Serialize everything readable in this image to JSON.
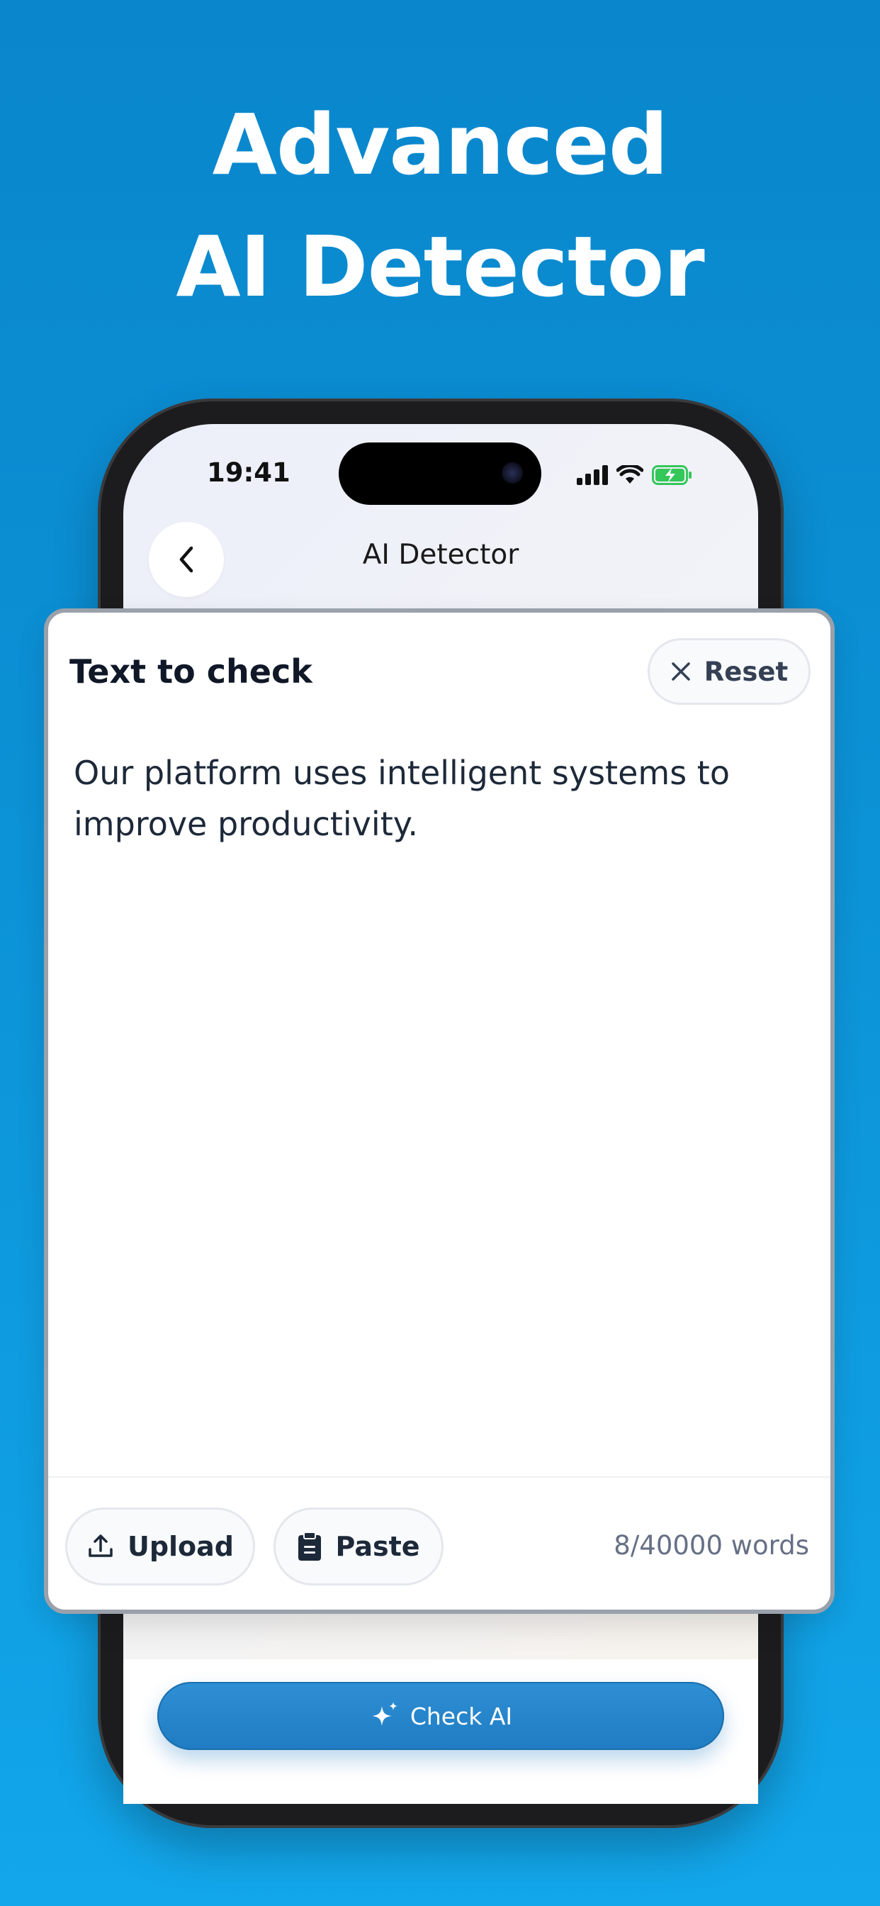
{
  "headline": {
    "line1": "Advanced",
    "line2": "AI Detector"
  },
  "status_bar": {
    "time": "19:41",
    "icons": [
      "cellular-signal-icon",
      "wifi-icon",
      "battery-charging-icon"
    ]
  },
  "nav": {
    "title": "AI Detector",
    "back_icon": "chevron-left-icon"
  },
  "card": {
    "title": "Text to check",
    "reset_label": "Reset",
    "text": "Our platform uses intelligent systems to improve productivity.",
    "upload_label": "Upload",
    "paste_label": "Paste",
    "word_count": "8/40000 words"
  },
  "check_button": {
    "label": "Check AI",
    "icon": "sparkles-icon"
  },
  "colors": {
    "background": "#0c92d6",
    "accent": "#1f7cc2",
    "battery": "#34c759"
  }
}
